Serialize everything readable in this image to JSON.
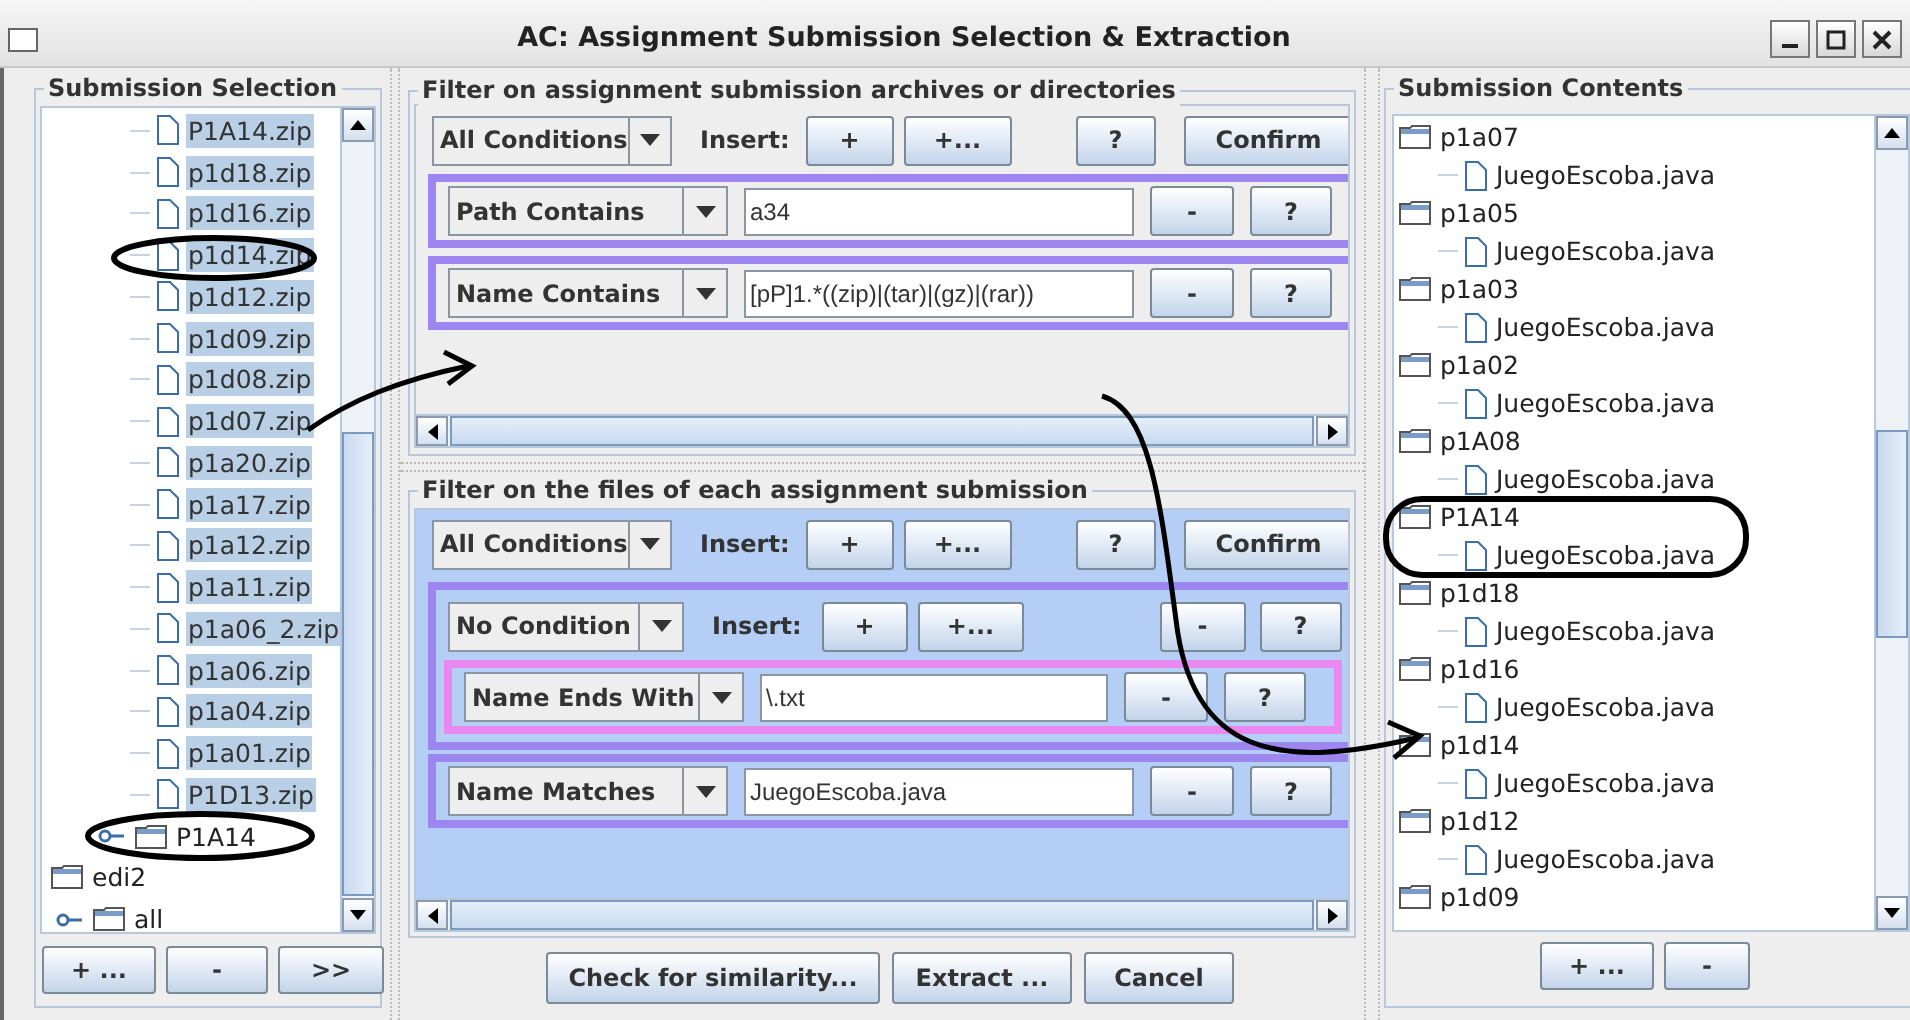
{
  "window": {
    "title": "AC: Assignment Submission Selection & Extraction"
  },
  "submission_selection": {
    "title": "Submission Selection",
    "tree": [
      {
        "children": [
          {
            "children": [
              {
                "label": "P1A14.zip",
                "kind": "file",
                "selected": true
              },
              {
                "label": "p1d18.zip",
                "kind": "file",
                "selected": true
              },
              {
                "label": "p1d16.zip",
                "kind": "file",
                "selected": true
              },
              {
                "label": "p1d14.zip",
                "kind": "file",
                "selected": true
              },
              {
                "label": "p1d12.zip",
                "kind": "file",
                "selected": true
              },
              {
                "label": "p1d09.zip",
                "kind": "file",
                "selected": true
              },
              {
                "label": "p1d08.zip",
                "kind": "file",
                "selected": true
              },
              {
                "label": "p1d07.zip",
                "kind": "file",
                "selected": true
              },
              {
                "label": "p1a20.zip",
                "kind": "file",
                "selected": true
              },
              {
                "label": "p1a17.zip",
                "kind": "file",
                "selected": true
              },
              {
                "label": "p1a12.zip",
                "kind": "file",
                "selected": true
              },
              {
                "label": "p1a11.zip",
                "kind": "file",
                "selected": true
              },
              {
                "label": "p1a06_2.zip",
                "kind": "file",
                "selected": true
              },
              {
                "label": "p1a06.zip",
                "kind": "file",
                "selected": true
              },
              {
                "label": "p1a04.zip",
                "kind": "file",
                "selected": true
              },
              {
                "label": "p1a01.zip",
                "kind": "file",
                "selected": true
              },
              {
                "label": "P1D13.zip",
                "kind": "file",
                "selected": true
              },
              {
                "label": "P1A14",
                "kind": "folder",
                "selected": false,
                "expanded": false
              }
            ]
          }
        ]
      },
      {
        "label": "edi2",
        "kind": "folder",
        "selected": false,
        "children": [
          {
            "label": "all",
            "kind": "folder",
            "selected": false,
            "expanded": false
          }
        ]
      }
    ],
    "add": "+ ...",
    "remove": "-",
    "transfer": ">>"
  },
  "archive_filter": {
    "title": "Filter on assignment submission archives or directories",
    "root": {
      "combo": "All Conditions",
      "insert_label": "Insert:",
      "add": "+",
      "add_more": "+...",
      "help": "?",
      "confirm": "Confirm"
    },
    "conditions": [
      {
        "kind": "condition",
        "combo": "Path Contains",
        "value": "a34",
        "remove": "-",
        "help": "?"
      },
      {
        "kind": "condition",
        "combo": "Name Contains",
        "value": "[pP]1.*((zip)|(tar)|(gz)|(rar))",
        "remove": "-",
        "help": "?"
      }
    ]
  },
  "file_filter": {
    "title": "Filter on the files of each assignment submission",
    "root": {
      "combo": "All Conditions",
      "insert_label": "Insert:",
      "add": "+",
      "add_more": "+...",
      "help": "?",
      "confirm": "Confirm"
    },
    "conditions": [
      {
        "kind": "group",
        "combo": "No Condition",
        "insert_label": "Insert:",
        "add": "+",
        "add_more": "+...",
        "remove": "-",
        "help": "?",
        "children": [
          {
            "kind": "condition",
            "combo": "Name Ends With",
            "value": "\\.txt",
            "remove": "-",
            "help": "?"
          }
        ]
      },
      {
        "kind": "condition",
        "combo": "Name Matches",
        "value": "JuegoEscoba.java",
        "remove": "-",
        "help": "?"
      }
    ]
  },
  "actions": {
    "similarity": "Check for similarity...",
    "extract": "Extract ...",
    "cancel": "Cancel"
  },
  "submission_contents": {
    "title": "Submission Contents",
    "tree": [
      {
        "label": "p1a07",
        "kind": "folder",
        "children": [
          {
            "label": "JuegoEscoba.java",
            "kind": "file"
          }
        ]
      },
      {
        "label": "p1a05",
        "kind": "folder",
        "children": [
          {
            "label": "JuegoEscoba.java",
            "kind": "file"
          }
        ]
      },
      {
        "label": "p1a03",
        "kind": "folder",
        "children": [
          {
            "label": "JuegoEscoba.java",
            "kind": "file"
          }
        ]
      },
      {
        "label": "p1a02",
        "kind": "folder",
        "children": [
          {
            "label": "JuegoEscoba.java",
            "kind": "file"
          }
        ]
      },
      {
        "label": "p1A08",
        "kind": "folder",
        "children": [
          {
            "label": "JuegoEscoba.java",
            "kind": "file"
          }
        ]
      },
      {
        "label": "P1A14",
        "kind": "folder",
        "children": [
          {
            "label": "JuegoEscoba.java",
            "kind": "file"
          }
        ]
      },
      {
        "label": "p1d18",
        "kind": "folder",
        "children": [
          {
            "label": "JuegoEscoba.java",
            "kind": "file"
          }
        ]
      },
      {
        "label": "p1d16",
        "kind": "folder",
        "children": [
          {
            "label": "JuegoEscoba.java",
            "kind": "file"
          }
        ]
      },
      {
        "label": "p1d14",
        "kind": "folder",
        "children": [
          {
            "label": "JuegoEscoba.java",
            "kind": "file"
          }
        ]
      },
      {
        "label": "p1d12",
        "kind": "folder",
        "children": [
          {
            "label": "JuegoEscoba.java",
            "kind": "file"
          }
        ]
      },
      {
        "label": "p1d09",
        "kind": "folder"
      }
    ],
    "add": "+ ...",
    "remove": "-"
  }
}
